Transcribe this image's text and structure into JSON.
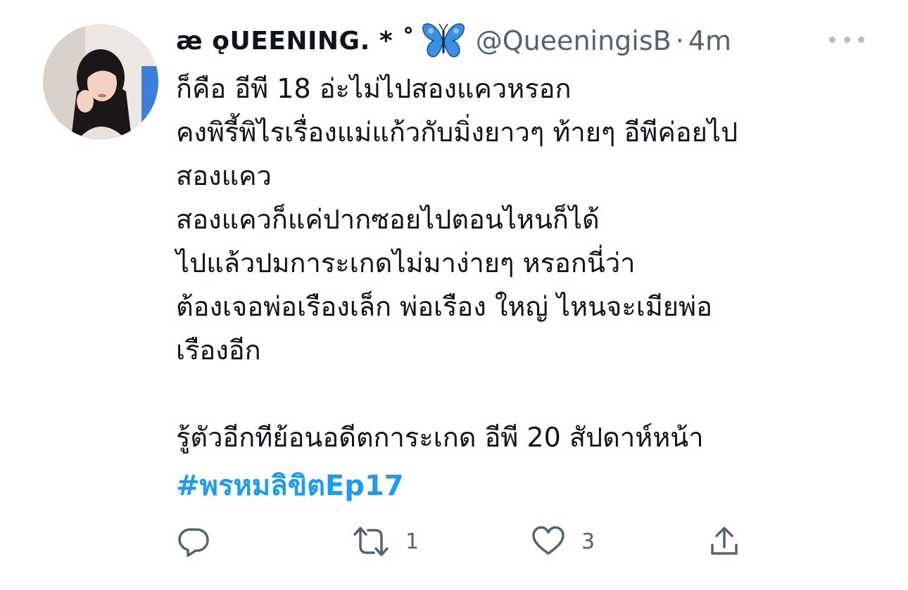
{
  "tweet": {
    "display_name": "æ ǫUEENING. * ˚",
    "handle": "@QueeningisB",
    "separator": "·",
    "time": "4m",
    "lines": [
      "ก็คือ อีพี 18 อ่ะไม่ไปสองแควหรอก",
      "คงพิรี้พิไรเรื่องแม่แก้วกับมิ่งยาวๆ ท้ายๆ อีพีค่อยไป",
      "สองแคว",
      "สองแควก็แค่ปากซอยไปตอนไหนก็ได้",
      "ไปแล้วปมการะเกดไม่มาง่ายๆ หรอกนี่ว่า",
      "ต้องเจอพ่อเรืองเล็ก พ่อเรือง ใหญ่ ไหนจะเมียพ่อ",
      "เรืองอีก",
      "",
      "รู้ตัวอีกทีย้อนอดีตการะเกด อีพี 20 สัปดาห์หน้า"
    ],
    "hashtag": "#พรหมลิขิตEp17"
  },
  "actions": {
    "reply_count": "",
    "retweet_count": "1",
    "like_count": "3"
  },
  "icons": {
    "emoji": "butterfly-icon",
    "more": "more-icon",
    "reply": "reply-icon",
    "retweet": "retweet-icon",
    "like": "heart-icon",
    "share": "share-icon"
  },
  "colors": {
    "text": "#0f1419",
    "secondary": "#536471",
    "link": "#1d9bf0",
    "butterfly": "#3b8fe0"
  }
}
